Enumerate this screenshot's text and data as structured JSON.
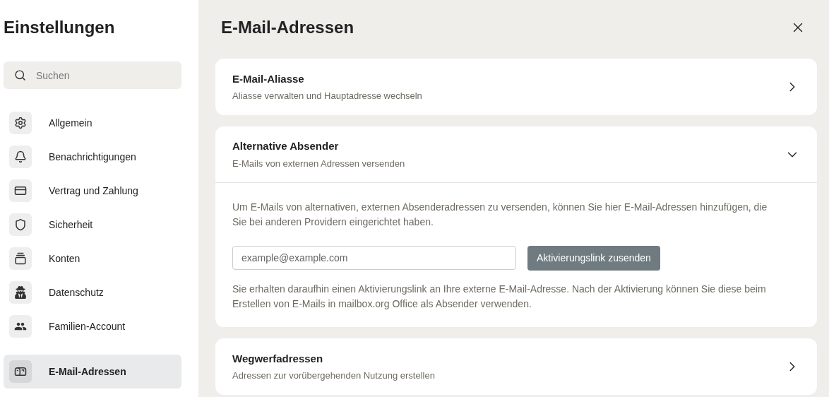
{
  "sidebar": {
    "title": "Einstellungen",
    "search": {
      "placeholder": "Suchen"
    },
    "items": [
      {
        "label": "Allgemein",
        "selected": false
      },
      {
        "label": "Benachrichtigungen",
        "selected": false
      },
      {
        "label": "Vertrag und Zahlung",
        "selected": false
      },
      {
        "label": "Sicherheit",
        "selected": false
      },
      {
        "label": "Konten",
        "selected": false
      },
      {
        "label": "Datenschutz",
        "selected": false
      },
      {
        "label": "Familien-Account",
        "selected": false
      },
      {
        "label": "E-Mail-Adressen",
        "selected": true
      }
    ]
  },
  "main": {
    "title": "E-Mail-Adressen",
    "sections": [
      {
        "title": "E-Mail-Aliasse",
        "subtitle": "Aliasse verwalten und Hauptadresse wechseln",
        "expanded": false
      },
      {
        "title": "Alternative Absender",
        "subtitle": "E-Mails von externen Adressen versenden",
        "expanded": true,
        "body": {
          "intro": "Um E-Mails von alternativen, externen Absenderadressen zu versenden, können Sie hier E-Mail-Adressen hinzufügen, die Sie bei anderen Providern eingerichtet haben.",
          "email_field": {
            "placeholder": "example@example.com"
          },
          "button": "Aktivierungslink zusenden",
          "note": "Sie erhalten daraufhin einen Aktivierungslink an Ihre externe E-Mail-Adresse. Nach der Aktivierung können Sie diese beim Erstellen von E-Mails in mailbox.org Office als Absender verwenden."
        }
      },
      {
        "title": "Wegwerfadressen",
        "subtitle": "Adressen zur vorübergehenden Nutzung erstellen",
        "expanded": false
      }
    ]
  }
}
